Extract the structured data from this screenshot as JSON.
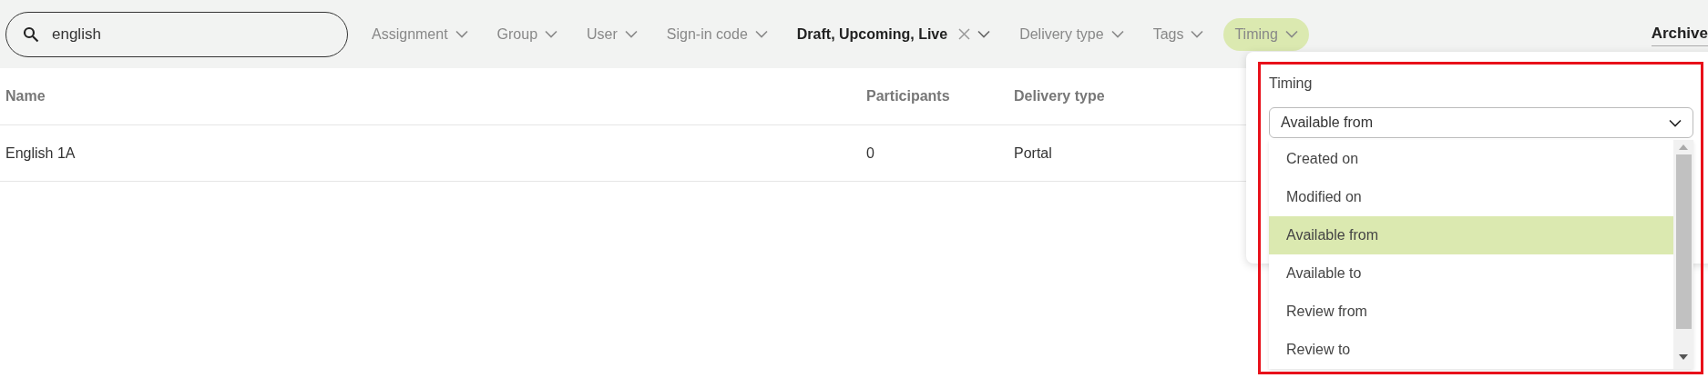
{
  "search": {
    "value": "english"
  },
  "filters": [
    {
      "label": "Assignment",
      "applied": false,
      "open": false
    },
    {
      "label": "Group",
      "applied": false,
      "open": false
    },
    {
      "label": "User",
      "applied": false,
      "open": false
    },
    {
      "label": "Sign-in code",
      "applied": false,
      "open": false
    },
    {
      "label": "Draft, Upcoming, Live",
      "applied": true,
      "open": false
    },
    {
      "label": "Delivery type",
      "applied": false,
      "open": false
    },
    {
      "label": "Tags",
      "applied": false,
      "open": false
    },
    {
      "label": "Timing",
      "applied": false,
      "open": true
    }
  ],
  "archive_link": {
    "label": "Archive"
  },
  "table": {
    "columns": [
      "Name",
      "Participants",
      "Delivery type"
    ],
    "rows": [
      [
        "English 1A",
        "0",
        "Portal"
      ]
    ]
  },
  "timing_dropdown": {
    "label": "Timing",
    "value": "Available from",
    "options": [
      {
        "label": "Created on",
        "selected": false
      },
      {
        "label": "Modified on",
        "selected": false
      },
      {
        "label": "Available from",
        "selected": true
      },
      {
        "label": "Available to",
        "selected": false
      },
      {
        "label": "Review from",
        "selected": false
      },
      {
        "label": "Review to",
        "selected": false
      }
    ]
  }
}
